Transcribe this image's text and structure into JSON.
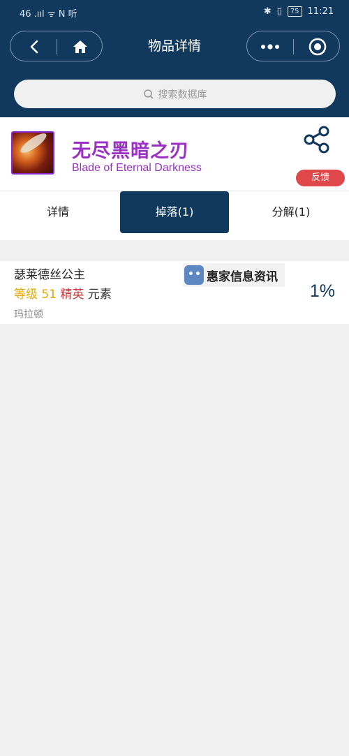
{
  "status_bar": {
    "left": "46 .ııl ᯤ N 听",
    "battery": "75",
    "time": "11:21"
  },
  "nav": {
    "title": "物品详情"
  },
  "search": {
    "placeholder": "搜索数据库"
  },
  "item": {
    "name": "无尽黑暗之刃",
    "name_en": "Blade of Eternal Darkness",
    "feedback_label": "反馈",
    "name_color": "#9b30c5"
  },
  "tabs": [
    {
      "label": "详情",
      "active": false
    },
    {
      "label": "掉落(1)",
      "active": true
    },
    {
      "label": "分解(1)",
      "active": false
    }
  ],
  "drops": [
    {
      "name": "瑟莱德丝公主",
      "level_label": "等级",
      "level": "51",
      "rank": "精英",
      "type": "元素",
      "zone": "玛拉顿",
      "rate": "1%"
    }
  ],
  "watermark": {
    "text": "惠家信息资讯"
  },
  "colors": {
    "primary": "#11395e",
    "elite": "#c9383b",
    "level": "#e6a700",
    "feedback": "#e0474b"
  }
}
